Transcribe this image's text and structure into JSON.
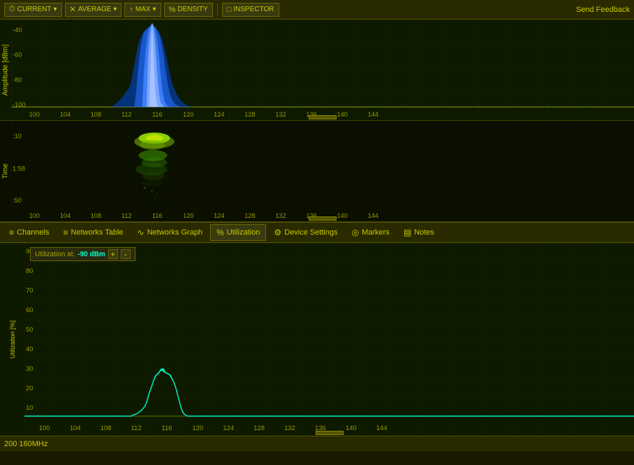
{
  "topbar": {
    "send_feedback": "Send Feedback",
    "buttons": [
      {
        "id": "current",
        "label": "CURRENT",
        "icon": "⏱",
        "has_dropdown": true
      },
      {
        "id": "average",
        "label": "AVERAGE",
        "icon": "✕",
        "has_dropdown": true
      },
      {
        "id": "max",
        "label": "MAX",
        "icon": "↑",
        "has_dropdown": true
      },
      {
        "id": "density",
        "label": "DENSITY",
        "icon": "%",
        "has_dropdown": false
      },
      {
        "id": "inspector",
        "label": "INSPECTOR",
        "icon": "□",
        "has_dropdown": false
      }
    ]
  },
  "spectrum": {
    "y_label": "Amplitude [dBm]",
    "y_ticks": [
      "-40",
      "-60",
      "-80",
      "-100"
    ],
    "x_ticks": [
      "100",
      "104",
      "108",
      "112",
      "116",
      "120",
      "124",
      "128",
      "132",
      "136",
      "140",
      "144"
    ]
  },
  "spectrogram": {
    "y_label": "Time",
    "y_ticks": [
      ":10",
      "1:58",
      ":50"
    ],
    "x_ticks": [
      "100",
      "104",
      "108",
      "112",
      "116",
      "120",
      "124",
      "128",
      "132",
      "136",
      "140",
      "144"
    ]
  },
  "tabs": [
    {
      "id": "channels",
      "label": "Channels",
      "icon": "≡",
      "active": false
    },
    {
      "id": "networks-table",
      "label": "Networks Table",
      "icon": "≡",
      "active": false
    },
    {
      "id": "networks-graph",
      "label": "Networks Graph",
      "icon": "∿",
      "active": false
    },
    {
      "id": "utilization",
      "label": "Utilization",
      "icon": "%",
      "active": true
    },
    {
      "id": "device-settings",
      "label": "Device Settings",
      "icon": "⚙",
      "active": false
    },
    {
      "id": "markers",
      "label": "Markers",
      "icon": "◎",
      "active": false
    },
    {
      "id": "notes",
      "label": "Notes",
      "icon": "▤",
      "active": false
    }
  ],
  "utilization": {
    "control_label": "Utilization at:",
    "control_value": "-90 dBm",
    "plus_label": "+",
    "minus_label": "-",
    "y_label": "Utilization [%]",
    "y_ticks": [
      "90",
      "80",
      "70",
      "60",
      "50",
      "40",
      "30",
      "20",
      "10"
    ],
    "x_ticks": [
      "100",
      "104",
      "108",
      "112",
      "116",
      "120",
      "124",
      "128",
      "132",
      "136",
      "140",
      "144"
    ]
  },
  "statusbar": {
    "left_text": "200 160MHz"
  },
  "colors": {
    "background": "#0d1a00",
    "grid": "#333300",
    "accent": "#c8c800",
    "spectrum_blue": "#0044ff",
    "util_line": "#00ffcc"
  }
}
